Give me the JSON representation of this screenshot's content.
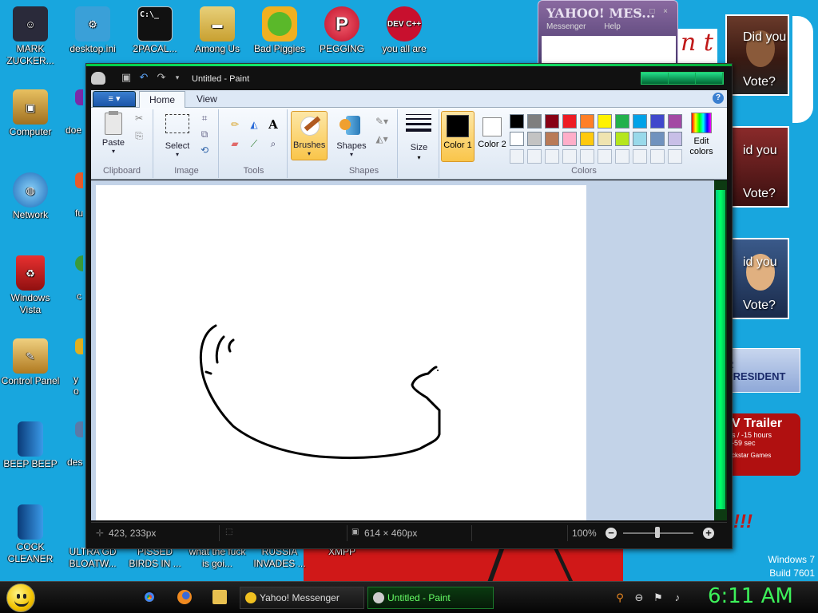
{
  "desktop": {
    "icons": [
      {
        "label": "MARK ZUCKER...",
        "glyph": "person-icon",
        "color": "#2a2a3a"
      },
      {
        "label": "desktop.ini",
        "glyph": "settings-file-icon",
        "color": "#3aa0d8"
      },
      {
        "label": "2PACAL...",
        "glyph": "cmd-icon",
        "color": "#111111"
      },
      {
        "label": "Among Us",
        "glyph": "folder-icon",
        "color": "#d8b84a"
      },
      {
        "label": "Bad Piggies",
        "glyph": "pig-icon",
        "color": "#5ab82a"
      },
      {
        "label": "PEGGING",
        "glyph": "p-logo-icon",
        "color": "#d0203a"
      },
      {
        "label": "you all are",
        "glyph": "devcpp-icon",
        "color": "#c8102e",
        "text": "DEV C++"
      },
      {
        "label": "Computer",
        "glyph": "computer-icon",
        "color": "#c09030"
      },
      {
        "label": "doe",
        "glyph": "app-icon",
        "color": "#7a2aa8"
      },
      {
        "label": "Network",
        "glyph": "network-icon",
        "color": "#2a8ad8"
      },
      {
        "label": "fu",
        "glyph": "app-icon",
        "color": "#e85a2a"
      },
      {
        "label": "Windows Vista",
        "glyph": "recycle-bin-icon",
        "color": "#c01818"
      },
      {
        "label": "c",
        "glyph": "chrome-icon",
        "color": "#3a9a3a"
      },
      {
        "label": "Control Panel",
        "glyph": "control-panel-icon",
        "color": "#b88a2a"
      },
      {
        "label": "yo",
        "glyph": "app-icon",
        "color": "#e0b020"
      },
      {
        "label": "BEEP BEEP",
        "glyph": "book-icon",
        "color": "#1a6ab8"
      },
      {
        "label": "des",
        "glyph": "app-icon",
        "color": "#5a7aa8"
      },
      {
        "label": "COCK CLEANER",
        "glyph": "book-icon",
        "color": "#1a6ab8"
      },
      {
        "label": "ULTRA GD BLOATW...",
        "glyph": "shortcut-icon",
        "color": "#888888"
      },
      {
        "label": "PISSED BIRDS IN ...",
        "glyph": "shortcut-icon",
        "color": "#888888"
      },
      {
        "label": "what the fuck is goi...",
        "glyph": "shortcut-icon",
        "color": "#888888"
      },
      {
        "label": "RUSSIA INVADES ...",
        "glyph": "shortcut-icon",
        "color": "#888888"
      },
      {
        "label": "XMPP",
        "glyph": "shortcut-icon",
        "color": "#888888"
      }
    ],
    "ads": {
      "vote_text_1": "Did you",
      "vote_text_2": "Vote?",
      "vote_text_3": "id you",
      "vote_text_4": "Vote?",
      "vote_text_5": "id you",
      "vote_text_6": "Vote?",
      "president": "R PRESIDENT",
      "trailer": "V Trailer",
      "trailer_sub": "s / -15 hours",
      "trailer_sub2": "-59 sec",
      "trailer_brand": "ckstar Games",
      "partial_text": "n t",
      "exclaim": "!!!"
    },
    "windows_label": "Windows 7",
    "build_label": "Build 7601"
  },
  "yahoo_window": {
    "title": "YAHOO! MES...",
    "menu": [
      "Messenger",
      "Help"
    ]
  },
  "paint": {
    "title": "Untitled - Paint",
    "file_menu_glyph": "≡",
    "tabs": [
      "Home",
      "View"
    ],
    "groups": {
      "clipboard": {
        "label": "Clipboard",
        "paste": "Paste"
      },
      "image": {
        "label": "Image",
        "select": "Select"
      },
      "tools": {
        "label": "Tools"
      },
      "brushes": {
        "label": "Brushes"
      },
      "shapes": {
        "label": "Shapes",
        "button": "Shapes"
      },
      "size": {
        "label": "Size"
      },
      "colors": {
        "label": "Colors",
        "color1": "Color 1",
        "color2": "Color 2",
        "edit": "Edit colors"
      }
    },
    "color1_value": "#000000",
    "color2_value": "#ffffff",
    "palette": [
      "#000000",
      "#7f7f7f",
      "#880015",
      "#ed1c24",
      "#ff7f27",
      "#fff200",
      "#22b14c",
      "#00a2e8",
      "#3f48cc",
      "#a349a4",
      "#ffffff",
      "#c3c3c3",
      "#b97a57",
      "#ffaec9",
      "#ffc90e",
      "#efe4b0",
      "#b5e61d",
      "#99d9ea",
      "#7092be",
      "#c8bfe7"
    ],
    "status": {
      "cursor_pos": "423, 233px",
      "canvas_size": "614 × 460px",
      "zoom": "100%"
    }
  },
  "taskbar": {
    "tasks": [
      {
        "label": "Yahoo! Messenger",
        "active": false
      },
      {
        "label": "Untitled - Paint",
        "active": true
      }
    ],
    "clock": "6:11 AM"
  }
}
